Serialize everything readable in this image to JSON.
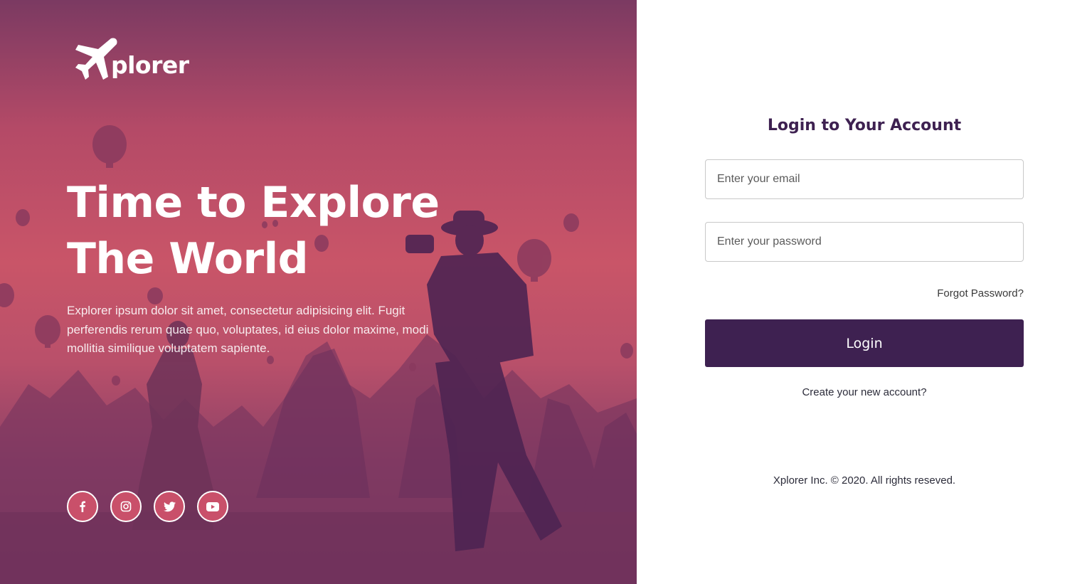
{
  "hero": {
    "title_line1": "Time to Explore",
    "title_line2": "The World",
    "description": "Explorer ipsum dolor sit amet, consectetur adipisicing elit. Fugit perferendis rerum quae quo, voluptates, id eius dolor maxime, modi mollitia similique voluptatem sapiente.",
    "overlay_color": "#c9506a",
    "social": [
      {
        "icon": "facebook-icon"
      },
      {
        "icon": "instagram-icon"
      },
      {
        "icon": "twitter-icon"
      },
      {
        "icon": "youtube-icon"
      }
    ]
  },
  "logo": {
    "text": "plorer",
    "icon": "airplane-icon"
  },
  "login": {
    "title": "Login to Your Account",
    "email_placeholder": "Enter your email",
    "password_placeholder": "Enter your password",
    "forgot_label": "Forgot Password?",
    "button_label": "Login",
    "create_label": "Create your new account?",
    "accent_color": "#3e2151"
  },
  "footer": {
    "text": "Xplorer Inc. © 2020. All rights reseved."
  }
}
